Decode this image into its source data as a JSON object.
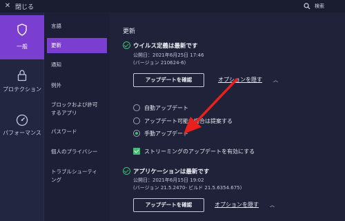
{
  "titlebar": {
    "close_label": "閉じる",
    "search_label": "検索"
  },
  "rail": {
    "items": [
      {
        "label": "一般",
        "icon": "shield-icon"
      },
      {
        "label": "プロテクション",
        "icon": "lock-icon"
      },
      {
        "label": "パフォーマンス",
        "icon": "gauge-icon"
      }
    ]
  },
  "subnav": {
    "items": [
      {
        "label": "言語"
      },
      {
        "label": "更新"
      },
      {
        "label": "通知"
      },
      {
        "label": "例外"
      },
      {
        "label_line1": "ブロックおよび許可",
        "label_line2": "するアプリ"
      },
      {
        "label": "パスワード"
      },
      {
        "label": "個人のプライバシー"
      },
      {
        "label_line1": "トラブルシューティ",
        "label_line2": "ング"
      }
    ]
  },
  "main": {
    "section_title": "更新",
    "virus": {
      "title": "ウイルス定義は最新です",
      "published": "公開日：2021年6月25日 17:46",
      "version": "(バージョン 210624-6)",
      "button": "アップデートを確認",
      "options_link": "オプションを隠す"
    },
    "options": {
      "radios": [
        {
          "label": "自動アップデート"
        },
        {
          "label": "アップデート可能な場合は提案する"
        },
        {
          "label": "手動アップデート"
        }
      ],
      "checkbox_label": "ストリーミングのアップデートを有効にする"
    },
    "app": {
      "title": "アプリケーションは最新です",
      "published": "公開日：2021年6月15日 19:02",
      "version": "(バージョン 21.5.2470- ビルド 21.5.6354.675)",
      "button": "アップデートを確認",
      "options_link": "オプションを隠す"
    }
  },
  "colors": {
    "accent": "#7a3fd1",
    "success": "#3fbf6f",
    "annotation": "#e8211c"
  }
}
